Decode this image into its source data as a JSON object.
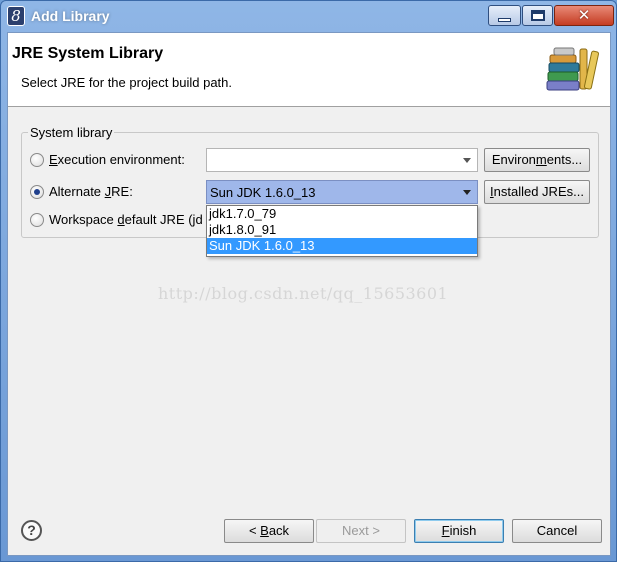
{
  "window": {
    "title": "Add Library",
    "app_icon_glyph": "8",
    "close_glyph": "✕"
  },
  "header": {
    "title": "JRE System Library",
    "subtitle": "Select JRE for the project build path."
  },
  "system_library": {
    "legend": "System library",
    "options": [
      {
        "label_pre": "",
        "mnemonic": "E",
        "label_post": "xecution environment:",
        "selected": false
      },
      {
        "label_pre": "Alternate ",
        "mnemonic": "J",
        "label_post": "RE:",
        "selected": true
      },
      {
        "label_pre": "Workspace ",
        "mnemonic": "d",
        "label_post": "efault JRE (jd",
        "selected": false
      }
    ],
    "execution_env_value": "",
    "alternate_jre_value": "Sun JDK 1.6.0_13",
    "environments_button": {
      "label_pre": "Environ",
      "mnemonic": "m",
      "label_post": "ents..."
    },
    "installed_jres_button": {
      "label_pre": "",
      "mnemonic": "I",
      "label_post": "nstalled JREs..."
    }
  },
  "jre_dropdown": {
    "items": [
      "jdk1.7.0_79",
      "jdk1.8.0_91",
      "Sun JDK 1.6.0_13"
    ],
    "selected_index": 2
  },
  "watermark": "http://blog.csdn.net/qq_15653601",
  "footer": {
    "help_glyph": "?",
    "back": {
      "label_pre": "< ",
      "mnemonic": "B",
      "label_post": "ack"
    },
    "next": {
      "label": "Next >"
    },
    "finish": {
      "label_pre": "",
      "mnemonic": "F",
      "label_post": "inish"
    },
    "cancel": {
      "label": "Cancel"
    }
  },
  "colors": {
    "titlebar_accent": "#6a98d4",
    "combo_active": "#9fb7ea",
    "list_selection": "#3399ff",
    "close_button": "#c43c22"
  }
}
